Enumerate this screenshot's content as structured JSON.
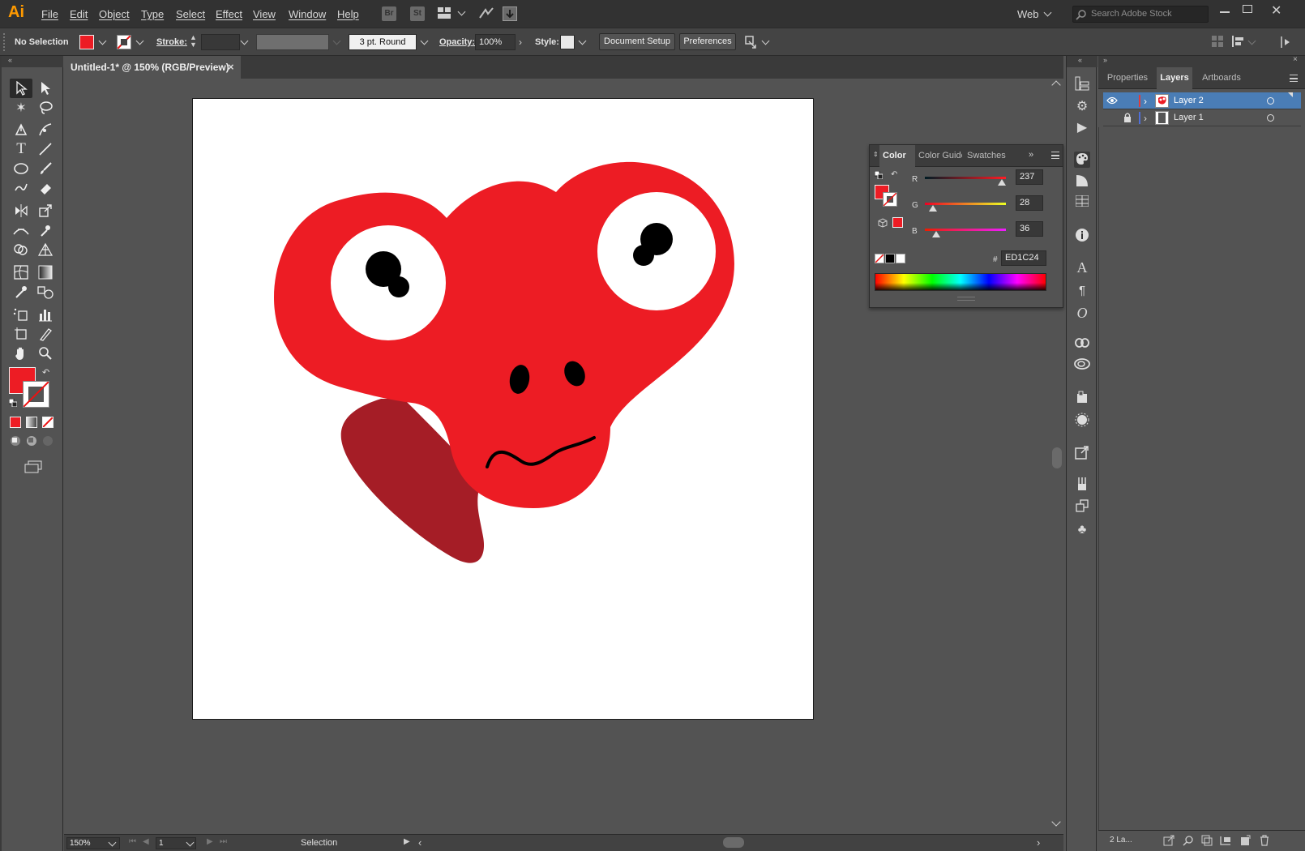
{
  "app": {
    "logo": "Ai",
    "menus": [
      "File",
      "Edit",
      "Object",
      "Type",
      "Select",
      "Effect",
      "View",
      "Window",
      "Help"
    ],
    "bridge_label": "Br",
    "stock_label": "St",
    "workspace": "Web",
    "search_placeholder": "Search Adobe Stock"
  },
  "control_bar": {
    "selection_status": "No Selection",
    "stroke_label": "Stroke:",
    "brush_profile": "3 pt. Round",
    "opacity_label": "Opacity:",
    "opacity_value": "100%",
    "style_label": "Style:",
    "document_setup": "Document Setup",
    "preferences": "Preferences",
    "fill_color": "#ED1C24"
  },
  "document": {
    "tab_title": "Untitled-1* @ 150% (RGB/Preview)",
    "close": "×"
  },
  "status_bar": {
    "zoom": "150%",
    "artboard_number": "1",
    "status": "Selection"
  },
  "color_panel": {
    "tabs": [
      "Color",
      "Color Guide",
      "Swatches"
    ],
    "r_label": "R",
    "g_label": "G",
    "b_label": "B",
    "r_value": "237",
    "g_value": "28",
    "b_value": "36",
    "hex_symbol": "#",
    "hex_value": "ED1C24"
  },
  "layers_panel": {
    "tabs": [
      "Properties",
      "Layers",
      "Artboards"
    ],
    "layers": [
      {
        "name": "Layer 2",
        "color": "#e03b3b",
        "selected": true,
        "visible": true,
        "locked": false
      },
      {
        "name": "Layer 1",
        "color": "#4f6fd8",
        "selected": false,
        "visible": false,
        "locked": true
      }
    ],
    "footer_count": "2 La..."
  },
  "colors": {
    "creature_red": "#ED1C24",
    "creature_dark": "#A51D26",
    "accent_blue": "#4a7db6"
  }
}
